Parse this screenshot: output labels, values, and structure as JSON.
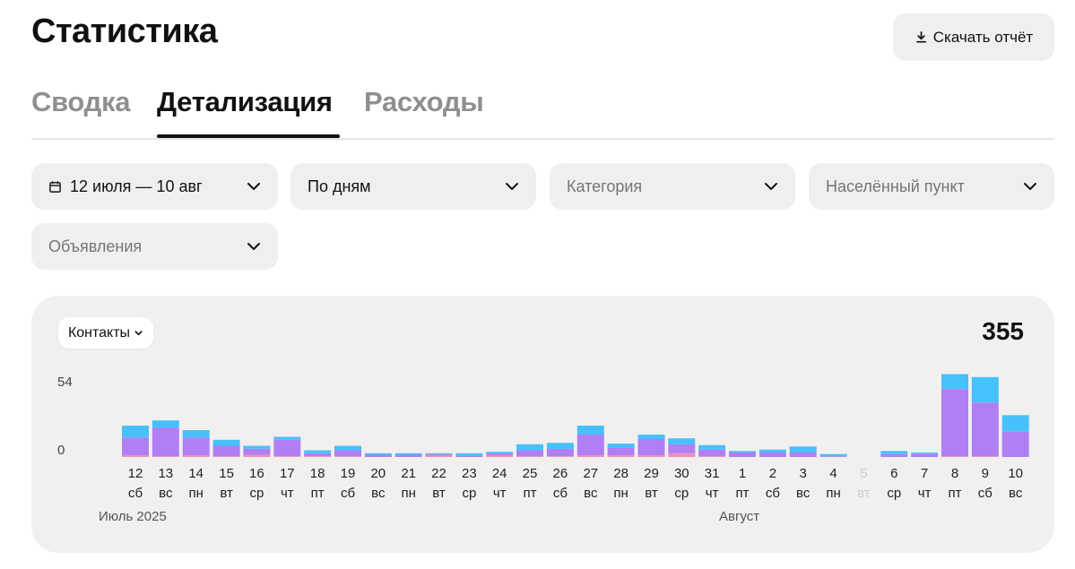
{
  "page": {
    "title": "Статистика",
    "download_label": "Скачать отчёт"
  },
  "tabs": [
    {
      "label": "Сводка",
      "active": false
    },
    {
      "label": "Детализация",
      "active": true
    },
    {
      "label": "Расходы",
      "active": false
    }
  ],
  "filters": {
    "period": "12 июля — 10 авг",
    "grouping": "По дням",
    "category_placeholder": "Категория",
    "city_placeholder": "Населённый пункт",
    "ads_placeholder": "Объявления"
  },
  "chart": {
    "metric_label": "Контакты",
    "total": "355",
    "month_labels": [
      "Июль 2025",
      "Август"
    ]
  },
  "colors": {
    "blue": "#47c1fb",
    "purple": "#b07ff3",
    "pink": "#f28db9",
    "card_bg": "#f1f0ef"
  },
  "chart_data": {
    "type": "bar",
    "stacked": true,
    "yticks": [
      "54",
      "0"
    ],
    "ylim": [
      0,
      54
    ],
    "days": [
      {
        "d": "12",
        "w": "сб"
      },
      {
        "d": "13",
        "w": "вс"
      },
      {
        "d": "14",
        "w": "пн"
      },
      {
        "d": "15",
        "w": "вт"
      },
      {
        "d": "16",
        "w": "ср"
      },
      {
        "d": "17",
        "w": "чт"
      },
      {
        "d": "18",
        "w": "пт"
      },
      {
        "d": "19",
        "w": "сб"
      },
      {
        "d": "20",
        "w": "вс"
      },
      {
        "d": "21",
        "w": "пн"
      },
      {
        "d": "22",
        "w": "вт"
      },
      {
        "d": "23",
        "w": "ср"
      },
      {
        "d": "24",
        "w": "чт"
      },
      {
        "d": "25",
        "w": "пт"
      },
      {
        "d": "26",
        "w": "сб"
      },
      {
        "d": "27",
        "w": "вс"
      },
      {
        "d": "28",
        "w": "пн"
      },
      {
        "d": "29",
        "w": "вт"
      },
      {
        "d": "30",
        "w": "ср"
      },
      {
        "d": "31",
        "w": "чт"
      },
      {
        "d": "1",
        "w": "пт"
      },
      {
        "d": "2",
        "w": "сб"
      },
      {
        "d": "3",
        "w": "вс"
      },
      {
        "d": "4",
        "w": "пн"
      },
      {
        "d": "5",
        "w": "вт",
        "muted": true
      },
      {
        "d": "6",
        "w": "ср"
      },
      {
        "d": "7",
        "w": "чт"
      },
      {
        "d": "8",
        "w": "пт"
      },
      {
        "d": "9",
        "w": "сб"
      },
      {
        "d": "10",
        "w": "вс"
      }
    ],
    "series": [
      {
        "color": "#f28db9",
        "values": [
          1,
          0.5,
          1,
          0.5,
          1.5,
          0.5,
          0.5,
          0.5,
          0,
          0,
          1,
          0,
          1,
          0.5,
          0.5,
          1,
          1,
          1,
          2.5,
          0.5,
          0,
          0,
          0,
          0,
          0,
          0,
          0,
          0.5,
          0.5,
          0
        ]
      },
      {
        "color": "#b07ff3",
        "values": [
          12,
          19,
          12,
          7,
          4,
          11,
          2,
          4,
          1.5,
          1.5,
          1,
          1,
          1.5,
          4,
          5,
          14,
          5,
          11,
          6,
          4.5,
          3,
          3,
          3,
          0.5,
          0,
          2,
          2,
          45,
          36,
          17
        ]
      },
      {
        "color": "#47c1fb",
        "values": [
          8,
          5,
          5,
          4,
          2,
          2,
          2,
          3,
          1,
          1,
          0.5,
          1.5,
          1,
          4,
          4,
          6,
          3,
          3,
          4,
          3,
          1,
          2,
          4,
          1.5,
          0,
          2,
          1,
          10,
          17,
          11
        ]
      }
    ]
  }
}
